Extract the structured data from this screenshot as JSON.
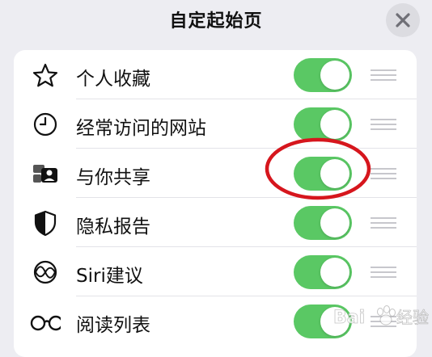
{
  "header": {
    "title": "自定起始页",
    "close_icon": "close-icon"
  },
  "rows": [
    {
      "label": "个人收藏",
      "icon": "star-icon",
      "enabled": true
    },
    {
      "label": "经常访问的网站",
      "icon": "clock-icon",
      "enabled": true
    },
    {
      "label": "与你共享",
      "icon": "shared-with-you-icon",
      "enabled": true
    },
    {
      "label": "隐私报告",
      "icon": "shield-icon",
      "enabled": true
    },
    {
      "label": "Siri建议",
      "icon": "siri-icon",
      "enabled": true
    },
    {
      "label": "阅读列表",
      "icon": "glasses-icon",
      "enabled": true
    }
  ],
  "colors": {
    "toggle_on": "#5ac864",
    "annotation": "#d6161d"
  },
  "watermark": {
    "text": "Baidu 经验"
  }
}
